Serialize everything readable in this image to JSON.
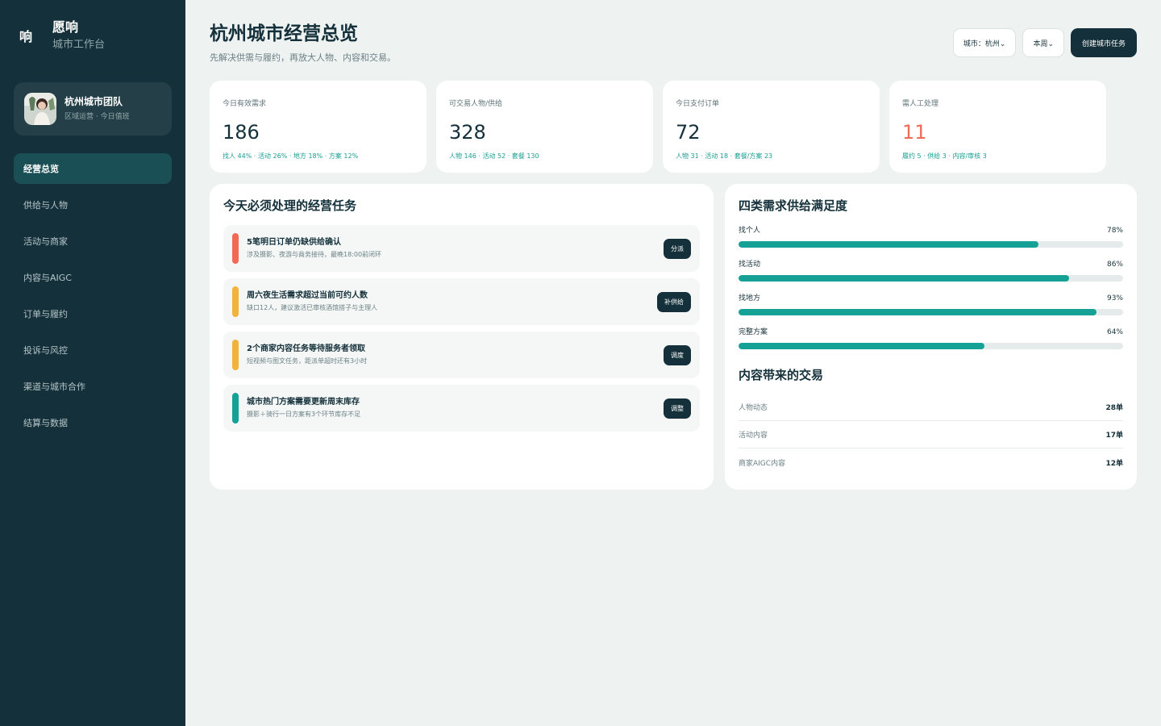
{
  "brand": {
    "mark": "响",
    "name": "愿响",
    "subtitle": "城市工作台"
  },
  "team": {
    "name": "杭州城市团队",
    "subtitle": "区域运营 · 今日值班"
  },
  "nav": [
    {
      "label": "经营总览",
      "active": true
    },
    {
      "label": "供给与人物"
    },
    {
      "label": "活动与商家"
    },
    {
      "label": "内容与AIGC"
    },
    {
      "label": "订单与履约"
    },
    {
      "label": "投诉与风控"
    },
    {
      "label": "渠道与城市合作"
    },
    {
      "label": "结算与数据"
    }
  ],
  "header": {
    "title": "杭州城市经营总览",
    "subtitle": "先解决供需与履约，再放大人物、内容和交易。",
    "city_select": "城市：杭州⌄",
    "period_select": "本周⌄",
    "create_label": "创建城市任务"
  },
  "stats": [
    {
      "label": "今日有效需求",
      "value": "186",
      "detail": "找人 44% · 活动 26% · 地方 18% · 方案 12%"
    },
    {
      "label": "可交易人物/供给",
      "value": "328",
      "detail": "人物 146 · 活动 52 · 套餐 130"
    },
    {
      "label": "今日支付订单",
      "value": "72",
      "detail": "人物 31 · 活动 18 · 套餐/方案 23"
    },
    {
      "label": "需人工处理",
      "value": "11",
      "detail": "履约 5 · 供给 3 · 内容/审核 3",
      "alert": true
    }
  ],
  "tasks": {
    "title": "今天必须处理的经营任务",
    "items": [
      {
        "title": "5笔明日订单仍缺供给确认",
        "desc": "涉及摄影、夜游与商务接待，最晚18:00前闭环",
        "button": "分派",
        "color": "#f06a55"
      },
      {
        "title": "周六夜生活需求超过当前可约人数",
        "desc": "缺口12人，建议激活已审核酒馆搭子与主理人",
        "button": "补供给",
        "color": "#f2b33d"
      },
      {
        "title": "2个商家内容任务等待服务者领取",
        "desc": "短视频与图文任务，距派单超时还有3小时",
        "button": "调度",
        "color": "#f2b33d"
      },
      {
        "title": "城市热门方案需要更新周末库存",
        "desc": "摄影＋骑行一日方案有3个环节库存不足",
        "button": "调整",
        "color": "#16a197"
      }
    ]
  },
  "supply": {
    "title": "四类需求供给满足度",
    "bars": [
      {
        "label": "找个人",
        "pct_label": "78%",
        "value": 78
      },
      {
        "label": "找活动",
        "pct_label": "86%",
        "value": 86
      },
      {
        "label": "找地方",
        "pct_label": "93%",
        "value": 93
      },
      {
        "label": "完整方案",
        "pct_label": "64%",
        "value": 64
      }
    ]
  },
  "transactions": {
    "title": "内容带来的交易",
    "rows": [
      {
        "name": "人物动态",
        "value": "28单"
      },
      {
        "name": "活动内容",
        "value": "17单"
      },
      {
        "name": "商家AIGC内容",
        "value": "12单"
      }
    ]
  },
  "colors": {
    "sidebar": "#14303a",
    "accent": "#16a197",
    "alert": "#f06a55",
    "warning": "#f2b33d"
  }
}
